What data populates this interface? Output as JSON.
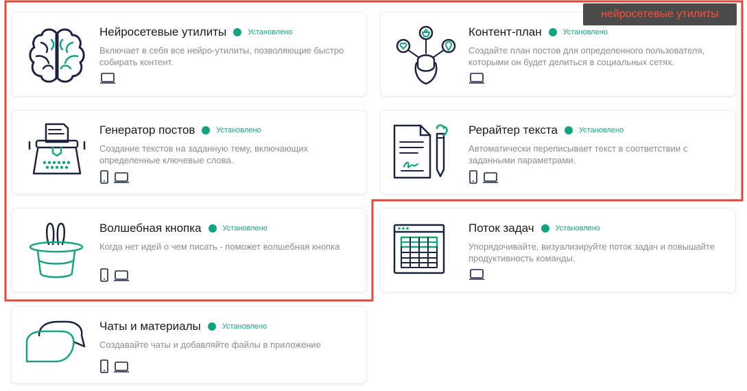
{
  "status_label": "Установлено",
  "highlight_label": "нейросетевые утилиты",
  "colors": {
    "accent": "#12a37f",
    "ink": "#1c2340",
    "highlight": "#e0473b"
  },
  "cards": [
    {
      "title": "Нейросетевые утилиты",
      "status": "Установлено",
      "description": "Включает в себя все нейро-утилиты, позволяющие быстро собирать контент.",
      "icon": "brain-icon",
      "devices": [
        "desktop"
      ]
    },
    {
      "title": "Контент-план",
      "status": "Установлено",
      "description": "Создайте план постов для определенного пользователя, которыми он будет делиться в социальных сетях.",
      "icon": "influencer-icon",
      "devices": [
        "desktop"
      ]
    },
    {
      "title": "Генератор постов",
      "status": "Установлено",
      "description": "Создание текстов на заданную тему, включающих определенные ключевые слова.",
      "icon": "typewriter-icon",
      "devices": [
        "mobile",
        "desktop"
      ]
    },
    {
      "title": "Рерайтер текста",
      "status": "Установлено",
      "description": "Автоматически переписывает текст в соответствии с заданными параметрами.",
      "icon": "document-pen-icon",
      "devices": [
        "mobile",
        "desktop"
      ]
    },
    {
      "title": "Волшебная кнопка",
      "status": "Установлено",
      "description": "Когда нет идей о чем писать - поможет волшебная кнопка",
      "icon": "magic-hat-icon",
      "devices": [
        "mobile",
        "desktop"
      ]
    },
    {
      "title": "Поток задач",
      "status": "Установлено",
      "description": "Упорядочивайте, визуализируйте поток задач и повышайте продуктивность команды.",
      "icon": "task-table-icon",
      "devices": [
        "desktop"
      ]
    },
    {
      "title": "Чаты и материалы",
      "status": "Установлено",
      "description": "Создавайте чаты и добавляйте файлы в приложение",
      "icon": "chat-bubbles-icon",
      "devices": [
        "mobile",
        "desktop"
      ]
    }
  ]
}
